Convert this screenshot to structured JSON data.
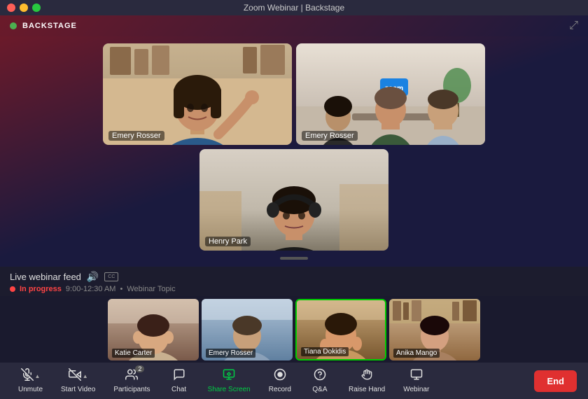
{
  "titleBar": {
    "title": "Zoom Webinar | Backstage",
    "trafficLights": [
      "red",
      "yellow",
      "green"
    ]
  },
  "backstage": {
    "label": "BACKSTAGE",
    "dotColor": "#4caf50"
  },
  "videoTiles": [
    {
      "id": "top-left",
      "name": "Emery Rosser",
      "person": "woman-waving"
    },
    {
      "id": "top-right",
      "name": "Emery Rosser",
      "person": "group"
    },
    {
      "id": "center",
      "name": "Henry Park",
      "person": "man-headphones"
    }
  ],
  "webinarInfo": {
    "title": "Live webinar feed",
    "status": "In progress",
    "time": "9:00-12:30 AM",
    "separator": "•",
    "topic": "Webinar Topic"
  },
  "bottomThumbs": [
    {
      "name": "Katie Carter",
      "active": false
    },
    {
      "name": "Emery Rosser",
      "active": false
    },
    {
      "name": "Tiana Dokidis",
      "active": true
    },
    {
      "name": "Anika Mango",
      "active": false
    }
  ],
  "toolbar": {
    "items": [
      {
        "id": "unmute",
        "label": "Unmute",
        "icon": "mic-off",
        "hasArrow": true,
        "active": false
      },
      {
        "id": "start-video",
        "label": "Start Video",
        "icon": "video-off",
        "hasArrow": true,
        "active": false
      },
      {
        "id": "participants",
        "label": "Participants",
        "icon": "people",
        "hasArrow": false,
        "active": false,
        "badge": "2"
      },
      {
        "id": "chat",
        "label": "Chat",
        "icon": "chat",
        "hasArrow": false,
        "active": false
      },
      {
        "id": "share-screen",
        "label": "Share Screen",
        "icon": "share",
        "hasArrow": false,
        "active": true
      },
      {
        "id": "record",
        "label": "Record",
        "icon": "record",
        "hasArrow": false,
        "active": false
      },
      {
        "id": "qa",
        "label": "Q&A",
        "icon": "qa",
        "hasArrow": false,
        "active": false
      },
      {
        "id": "raise-hand",
        "label": "Raise Hand",
        "icon": "hand",
        "hasArrow": false,
        "active": false
      },
      {
        "id": "webinar",
        "label": "Webinar",
        "icon": "webinar",
        "hasArrow": false,
        "active": false
      }
    ],
    "endButton": "End"
  }
}
